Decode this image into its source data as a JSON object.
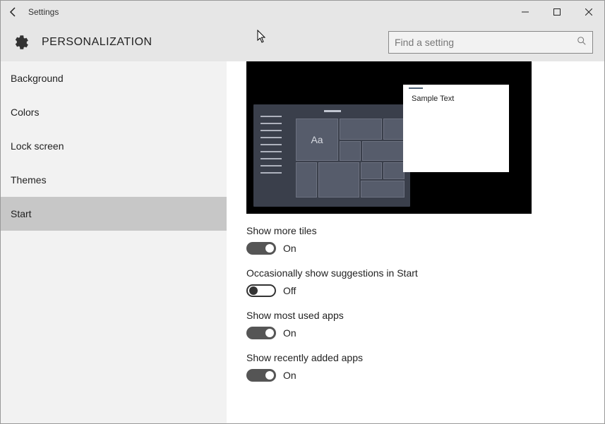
{
  "window": {
    "title": "Settings"
  },
  "header": {
    "title": "PERSONALIZATION",
    "search_placeholder": "Find a setting"
  },
  "sidebar": {
    "items": [
      {
        "label": "Background",
        "selected": false
      },
      {
        "label": "Colors",
        "selected": false
      },
      {
        "label": "Lock screen",
        "selected": false
      },
      {
        "label": "Themes",
        "selected": false
      },
      {
        "label": "Start",
        "selected": true
      }
    ]
  },
  "preview": {
    "tile_text": "Aa",
    "window_text": "Sample Text"
  },
  "settings": [
    {
      "label": "Show more tiles",
      "on": true,
      "state_text": "On"
    },
    {
      "label": "Occasionally show suggestions in Start",
      "on": false,
      "state_text": "Off"
    },
    {
      "label": "Show most used apps",
      "on": true,
      "state_text": "On"
    },
    {
      "label": "Show recently added apps",
      "on": true,
      "state_text": "On"
    }
  ]
}
